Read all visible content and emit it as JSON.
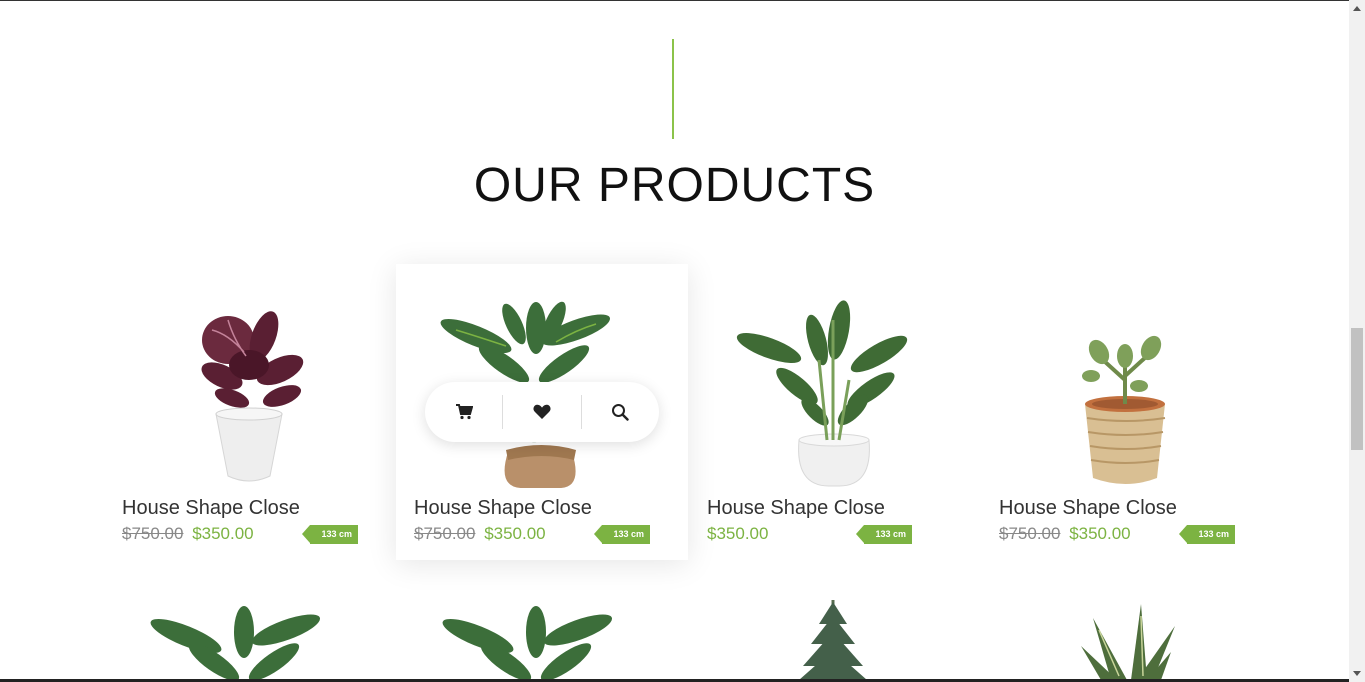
{
  "section": {
    "title": "OUR PRODUCTS",
    "accent_color": "#8bc34a",
    "price_color": "#7cb342"
  },
  "products": [
    {
      "name": "House Shape Close",
      "old_price": "$750.00",
      "price": "$350.00",
      "tag": "133 cm",
      "plant": "calathea-dark-red"
    },
    {
      "name": "House Shape Close",
      "old_price": "$750.00",
      "price": "$350.00",
      "tag": "133 cm",
      "plant": "calathea-burlap"
    },
    {
      "name": "House Shape Close",
      "old_price": "",
      "price": "$350.00",
      "tag": "133 cm",
      "plant": "dieffenbachia"
    },
    {
      "name": "House Shape Close",
      "old_price": "$750.00",
      "price": "$350.00",
      "tag": "133 cm",
      "plant": "jade-basket"
    }
  ],
  "product_actions": {
    "icons": [
      "cart-icon",
      "heart-icon",
      "search-icon"
    ]
  },
  "second_row_plants": [
    "calathea",
    "calathea",
    "fir-tree",
    "snake-plant"
  ]
}
